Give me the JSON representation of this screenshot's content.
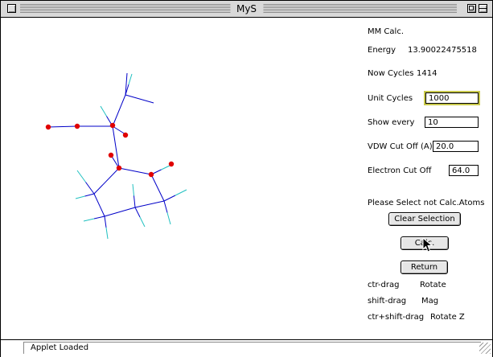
{
  "window": {
    "title": "MyS"
  },
  "panel": {
    "mm_calc": "MM Calc.",
    "energy_label": "Energy",
    "energy_value": "13.90022475518",
    "now_cycles_label": "Now Cycles",
    "now_cycles_value": "1414",
    "unit_cycles_label": "Unit Cycles",
    "unit_cycles_value": "1000",
    "show_every_label": "Show every",
    "show_every_value": "10",
    "vdw_label": "VDW Cut Off (A)",
    "vdw_value": "20.0",
    "electron_label": "Electron Cut Off",
    "electron_value": "64.0",
    "select_msg": "Please Select not Calc.Atoms",
    "clear_button": "Clear Selection",
    "calc_button": "Calc.",
    "return_button": "Return",
    "help": [
      {
        "action": "ctr-drag",
        "effect": "Rotate"
      },
      {
        "action": "shift-drag",
        "effect": "Mag"
      },
      {
        "action": "ctr+shift-drag",
        "effect": "Rotate Z"
      }
    ]
  },
  "status": {
    "text": "Applet Loaded"
  },
  "colors": {
    "bond": "#0000c8",
    "hydrogen": "#20c0c0",
    "atom": "#e00000"
  }
}
